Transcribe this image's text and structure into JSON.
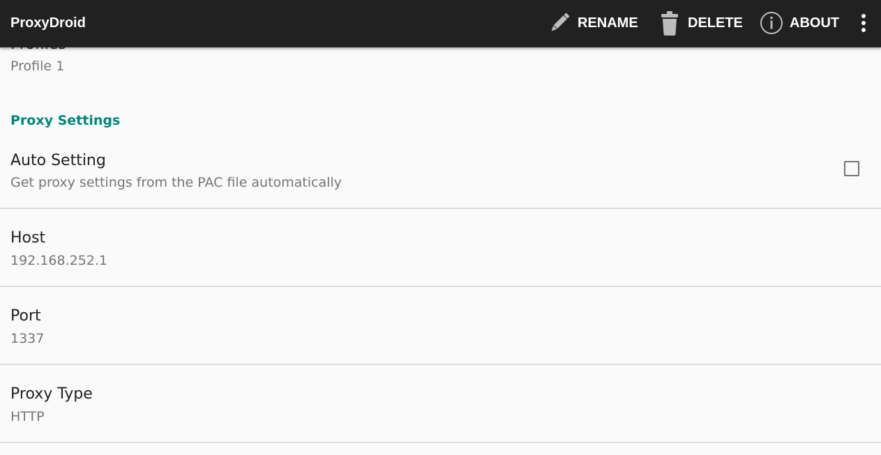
{
  "appbar": {
    "title": "ProxyDroid",
    "actions": [
      {
        "label": "RENAME",
        "icon": "pencil-icon"
      },
      {
        "label": "DELETE",
        "icon": "trash-icon"
      },
      {
        "label": "ABOUT",
        "icon": "info-icon"
      }
    ],
    "overflow_icon": "more-vert-icon"
  },
  "profile": {
    "title": "Profiles",
    "value": "Profile 1"
  },
  "category": "Proxy Settings",
  "preferences": [
    {
      "title": "Auto Setting",
      "summary": "Get proxy settings from the PAC file automatically",
      "checked": false
    },
    {
      "title": "Host",
      "summary": "192.168.252.1"
    },
    {
      "title": "Port",
      "summary": "1337"
    },
    {
      "title": "Proxy Type",
      "summary": "HTTP"
    }
  ],
  "colors": {
    "appbar": "#212121",
    "category": "#00897b",
    "background": "#fafafa"
  }
}
